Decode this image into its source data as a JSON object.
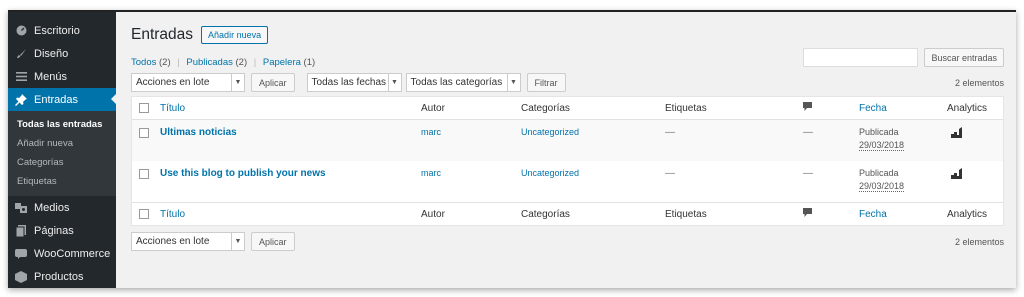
{
  "sidebar": {
    "items": [
      {
        "label": "Escritorio",
        "icon": "dashboard-icon"
      },
      {
        "label": "Diseño",
        "icon": "brush-icon"
      },
      {
        "label": "Menús",
        "icon": "menu-icon"
      },
      {
        "label": "Entradas",
        "icon": "pin-icon",
        "active": true
      },
      {
        "label": "Medios",
        "icon": "media-icon"
      },
      {
        "label": "Páginas",
        "icon": "pages-icon"
      },
      {
        "label": "WooCommerce",
        "icon": "woo-icon"
      },
      {
        "label": "Productos",
        "icon": "products-icon"
      }
    ],
    "submenu": [
      "Todas las entradas",
      "Añadir nueva",
      "Categorías",
      "Etiquetas"
    ]
  },
  "header": {
    "title": "Entradas",
    "add_new": "Añadir nueva"
  },
  "filters": {
    "all_label": "Todos",
    "all_count": "(2)",
    "published_label": "Publicadas",
    "published_count": "(2)",
    "trash_label": "Papelera",
    "trash_count": "(1)"
  },
  "search": {
    "button": "Buscar entradas",
    "placeholder": ""
  },
  "tablenav": {
    "bulk_action": "Acciones en lote",
    "apply": "Aplicar",
    "dates": "Todas las fechas",
    "categories": "Todas las categorías",
    "filter": "Filtrar",
    "count": "2 elementos"
  },
  "table": {
    "columns": {
      "title": "Título",
      "author": "Autor",
      "categories": "Categorías",
      "tags": "Etiquetas",
      "date": "Fecha",
      "analytics": "Analytics"
    },
    "rows": [
      {
        "title": "Ultimas noticias",
        "author": "marc",
        "categories": "Uncategorized",
        "tags": "—",
        "comments": "—",
        "status": "Publicada",
        "date": "29/03/2018"
      },
      {
        "title": "Use this blog to publish your news",
        "author": "marc",
        "categories": "Uncategorized",
        "tags": "—",
        "comments": "—",
        "status": "Publicada",
        "date": "29/03/2018"
      }
    ]
  },
  "colors": {
    "sidebar_bg": "#23282d",
    "active": "#0073aa",
    "link": "#0073aa"
  }
}
